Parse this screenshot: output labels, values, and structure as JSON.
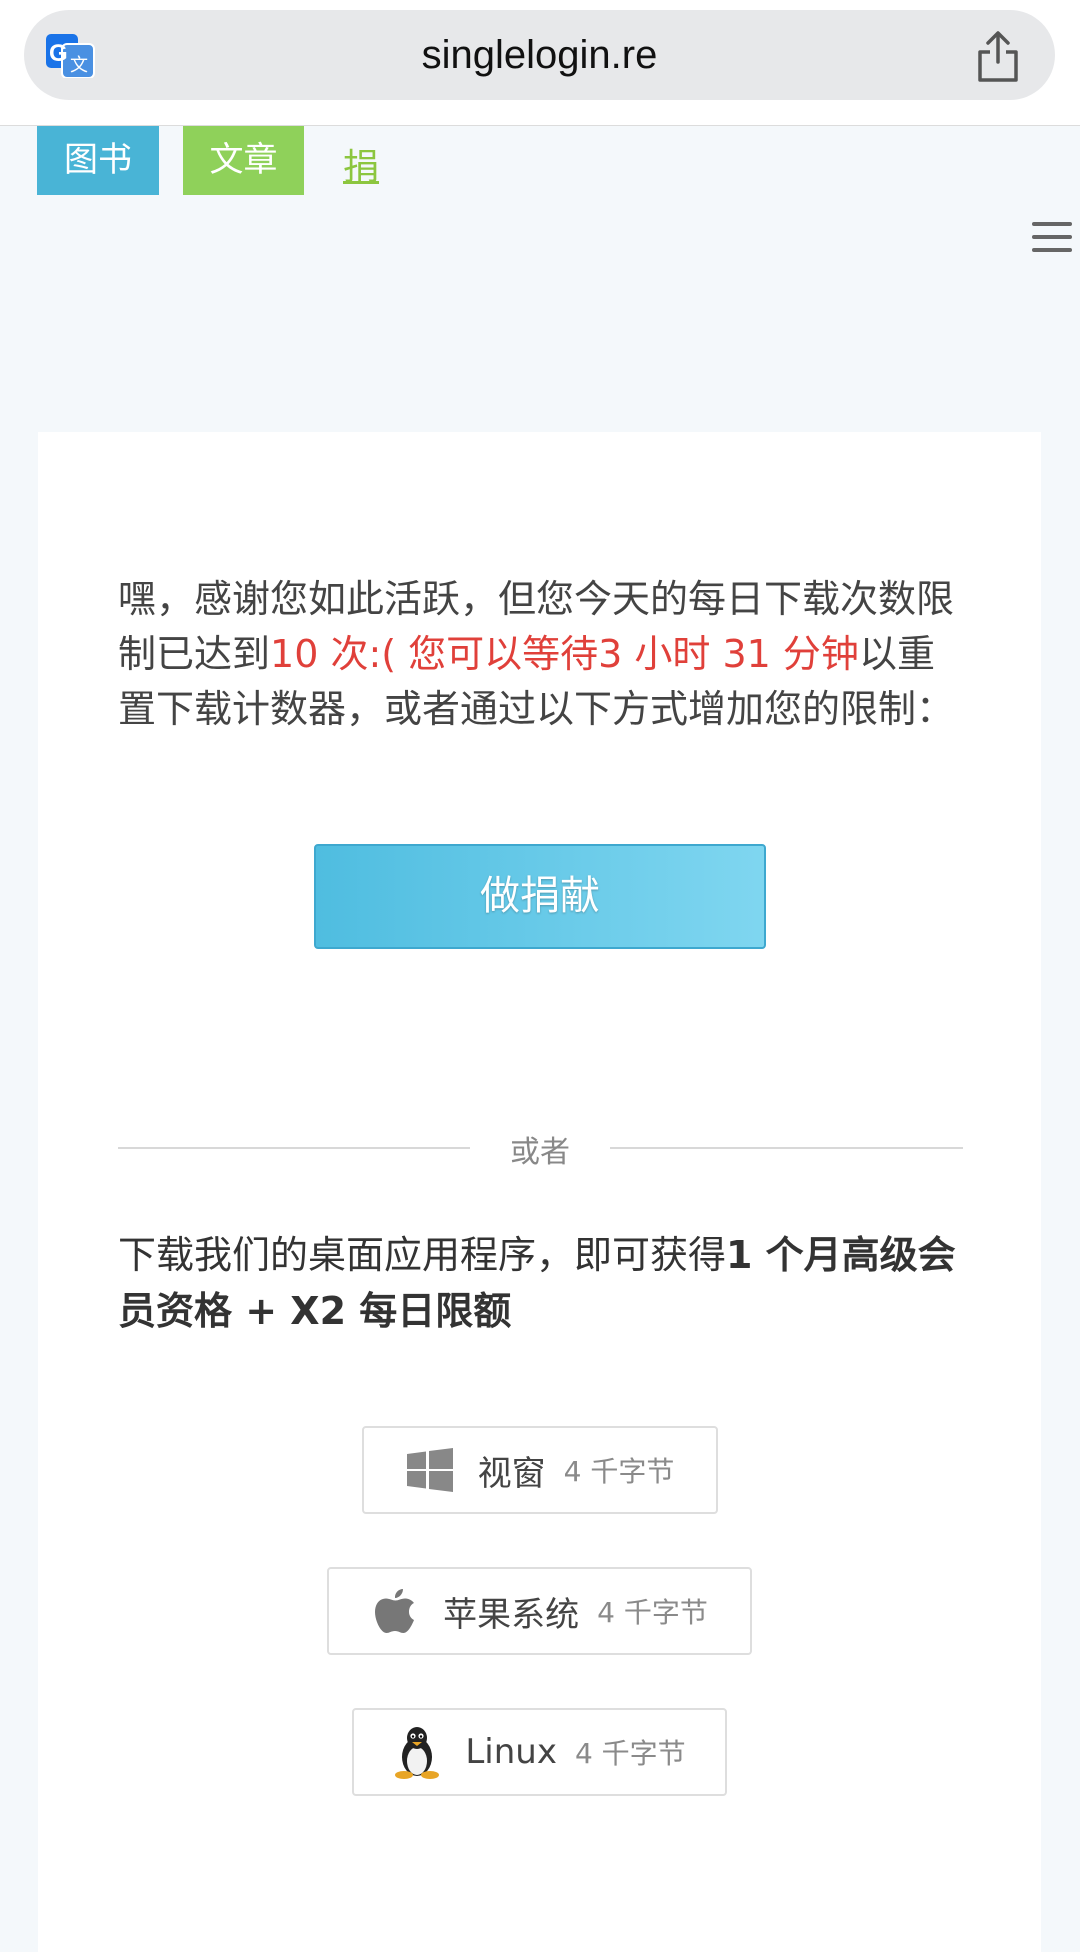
{
  "browser": {
    "url": "singlelogin.re"
  },
  "nav": {
    "books": "图书",
    "articles": "文章",
    "donate": "捐"
  },
  "message": {
    "part1": "嘿，感谢您如此活跃，但您今天的每日下载次数限制已达到",
    "highlight": "10 次:( 您可以等待3 小时 31 分钟",
    "part2": "以重置下载计数器，或者通过以下方式增加您的限制："
  },
  "donate_button": "做捐献",
  "divider_text": "或者",
  "promo": {
    "part1": "下载我们的桌面应用程序，即可获得",
    "bold": "1 个月高级会员资格 + X2 每日限额"
  },
  "downloads": [
    {
      "icon": "windows-icon",
      "name": "视窗",
      "size": "4 千字节"
    },
    {
      "icon": "apple-icon",
      "name": "苹果系统",
      "size": "4 千字节"
    },
    {
      "icon": "linux-icon",
      "name": "Linux",
      "size": "4 千字节"
    }
  ],
  "colors": {
    "books_tab": "#49b4d6",
    "articles_tab": "#8fd15a",
    "donate_link": "#8cc63f",
    "highlight_text": "#e0403a",
    "donate_button": "#5cc5e6"
  }
}
